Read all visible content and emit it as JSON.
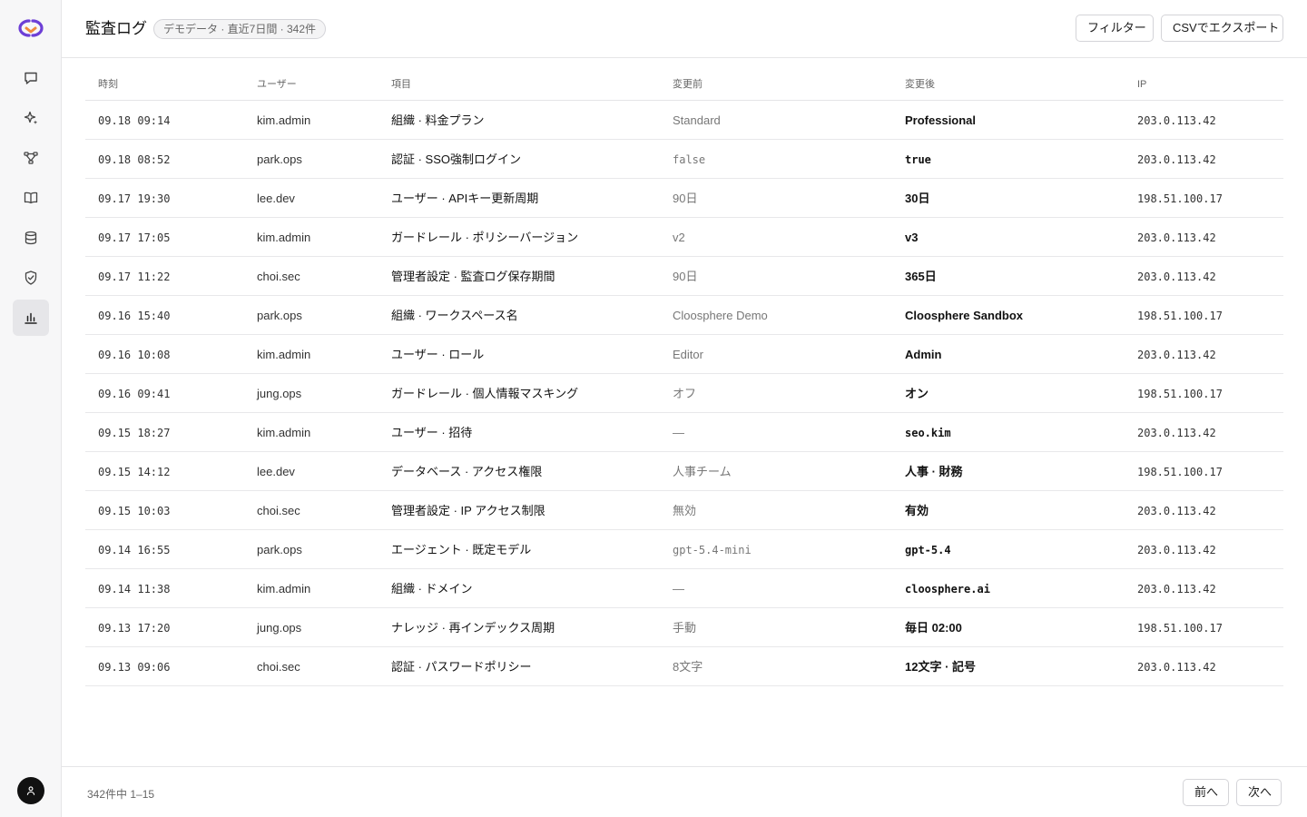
{
  "header": {
    "title": "監査ログ",
    "badge": "デモデータ · 直近7日間 · 342件",
    "filter_label": "フィルター",
    "export_label": "CSVでエクスポート"
  },
  "sidebar": {
    "items": [
      {
        "name": "chat",
        "icon": "chat-bubble-icon"
      },
      {
        "name": "ai",
        "icon": "sparkles-icon"
      },
      {
        "name": "workflow",
        "icon": "workflow-icon"
      },
      {
        "name": "knowledge",
        "icon": "book-icon"
      },
      {
        "name": "database",
        "icon": "database-icon"
      },
      {
        "name": "guardrails",
        "icon": "shield-check-icon"
      },
      {
        "name": "analytics",
        "icon": "bar-chart-icon",
        "active": true
      }
    ]
  },
  "table": {
    "columns": {
      "time": "時刻",
      "user": "ユーザー",
      "item": "項目",
      "before": "変更前",
      "after": "変更後",
      "ip": "IP"
    },
    "rows": [
      {
        "time": "09.18 09:14",
        "user": "kim.admin",
        "item": "組織 · 料金プラン",
        "before": "Standard",
        "after": "Professional",
        "ip": "203.0.113.42"
      },
      {
        "time": "09.18 08:52",
        "user": "park.ops",
        "item": "認証 · SSO強制ログイン",
        "before": "false",
        "after": "true",
        "ip": "203.0.113.42",
        "mono": true
      },
      {
        "time": "09.17 19:30",
        "user": "lee.dev",
        "item": "ユーザー · APIキー更新周期",
        "before": "90日",
        "after": "30日",
        "ip": "198.51.100.17"
      },
      {
        "time": "09.17 17:05",
        "user": "kim.admin",
        "item": "ガードレール · ポリシーバージョン",
        "before": "v2",
        "after": "v3",
        "ip": "203.0.113.42"
      },
      {
        "time": "09.17 11:22",
        "user": "choi.sec",
        "item": "管理者設定 · 監査ログ保存期間",
        "before": "90日",
        "after": "365日",
        "ip": "203.0.113.42"
      },
      {
        "time": "09.16 15:40",
        "user": "park.ops",
        "item": "組織 · ワークスペース名",
        "before": "Cloosphere Demo",
        "after": "Cloosphere Sandbox",
        "ip": "198.51.100.17"
      },
      {
        "time": "09.16 10:08",
        "user": "kim.admin",
        "item": "ユーザー · ロール",
        "before": "Editor",
        "after": "Admin",
        "ip": "203.0.113.42"
      },
      {
        "time": "09.16 09:41",
        "user": "jung.ops",
        "item": "ガードレール · 個人情報マスキング",
        "before": "オフ",
        "after": "オン",
        "ip": "198.51.100.17"
      },
      {
        "time": "09.15 18:27",
        "user": "kim.admin",
        "item": "ユーザー · 招待",
        "before": "—",
        "after": "seo.kim",
        "ip": "203.0.113.42",
        "mono_after": true
      },
      {
        "time": "09.15 14:12",
        "user": "lee.dev",
        "item": "データベース · アクセス権限",
        "before": "人事チーム",
        "after": "人事 · 財務",
        "ip": "198.51.100.17"
      },
      {
        "time": "09.15 10:03",
        "user": "choi.sec",
        "item": "管理者設定 · IP アクセス制限",
        "before": "無効",
        "after": "有効",
        "ip": "203.0.113.42"
      },
      {
        "time": "09.14 16:55",
        "user": "park.ops",
        "item": "エージェント · 既定モデル",
        "before": "gpt-5.4-mini",
        "after": "gpt-5.4",
        "ip": "203.0.113.42",
        "mono": true
      },
      {
        "time": "09.14 11:38",
        "user": "kim.admin",
        "item": "組織 · ドメイン",
        "before": "—",
        "after": "cloosphere.ai",
        "ip": "203.0.113.42",
        "mono_after": true
      },
      {
        "time": "09.13 17:20",
        "user": "jung.ops",
        "item": "ナレッジ · 再インデックス周期",
        "before": "手動",
        "after": "毎日 02:00",
        "ip": "198.51.100.17"
      },
      {
        "time": "09.13 09:06",
        "user": "choi.sec",
        "item": "認証 · パスワードポリシー",
        "before": "8文字",
        "after": "12文字 · 記号",
        "ip": "203.0.113.42"
      }
    ]
  },
  "footer": {
    "count": "342件中 1–15",
    "prev_label": "前へ",
    "next_label": "次へ"
  },
  "colors": {
    "accent": "#6d3fd6",
    "brand_orange": "#f08a3c",
    "border": "#e5e5e7"
  }
}
